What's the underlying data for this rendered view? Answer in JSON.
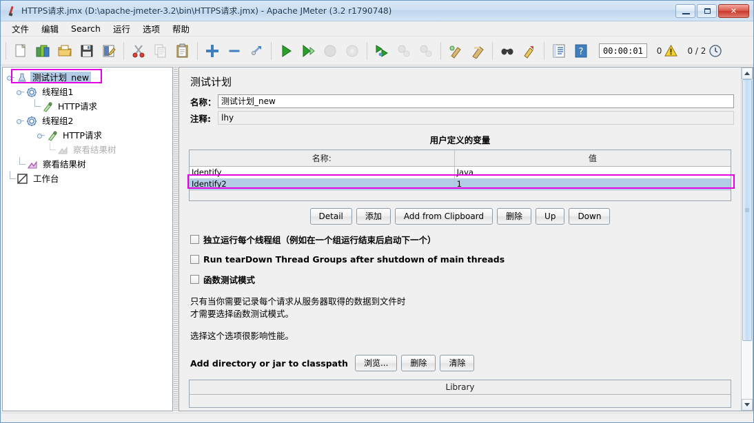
{
  "window": {
    "title": "HTTPS请求.jmx (D:\\apache-jmeter-3.2\\bin\\HTTPS请求.jmx) - Apache JMeter (3.2 r1790748)",
    "app_icon": "jmeter-feather-icon",
    "minimize_label": "–",
    "maximize_label": "□",
    "close_label": "✕"
  },
  "menubar": {
    "items": [
      {
        "label": "文件",
        "name": "menu-file"
      },
      {
        "label": "编辑",
        "name": "menu-edit"
      },
      {
        "label": "Search",
        "name": "menu-search"
      },
      {
        "label": "运行",
        "name": "menu-run"
      },
      {
        "label": "选项",
        "name": "menu-options"
      },
      {
        "label": "帮助",
        "name": "menu-help"
      }
    ]
  },
  "toolbar": {
    "buttons": [
      {
        "name": "new-icon",
        "title": "New"
      },
      {
        "name": "templates-icon",
        "title": "Templates"
      },
      {
        "name": "open-icon",
        "title": "Open"
      },
      {
        "name": "save-icon",
        "title": "Save"
      },
      {
        "name": "save-as-icon",
        "title": "Save as"
      },
      {
        "name": "cut-icon",
        "title": "Cut"
      },
      {
        "name": "copy-icon",
        "title": "Copy"
      },
      {
        "name": "paste-icon",
        "title": "Paste"
      },
      {
        "name": "expand-all-icon",
        "title": "Expand all"
      },
      {
        "name": "collapse-all-icon",
        "title": "Collapse all"
      },
      {
        "name": "toggle-icon",
        "title": "Toggle"
      },
      {
        "name": "start-icon",
        "title": "Start"
      },
      {
        "name": "start-no-pauses-icon",
        "title": "Start no pauses"
      },
      {
        "name": "stop-icon",
        "title": "Stop"
      },
      {
        "name": "shutdown-icon",
        "title": "Shutdown"
      },
      {
        "name": "remote-start-all-icon",
        "title": "Remote start all"
      },
      {
        "name": "remote-stop-all-icon",
        "title": "Remote stop all"
      },
      {
        "name": "remote-shutdown-all-icon",
        "title": "Remote shutdown all"
      },
      {
        "name": "clear-icon",
        "title": "Clear"
      },
      {
        "name": "clear-all-icon",
        "title": "Clear all"
      },
      {
        "name": "search-icon",
        "title": "Search"
      },
      {
        "name": "reset-search-icon",
        "title": "Reset search"
      },
      {
        "name": "function-helper-icon",
        "title": "Function helper dialog"
      },
      {
        "name": "help-icon",
        "title": "Help"
      }
    ],
    "elapsed_time": "00:00:01",
    "warning_count": "0",
    "warning_icon": "warning-triangle-icon",
    "thread_counter": "0 / 2",
    "clock_icon": "clock-icon"
  },
  "tree": {
    "nodes": [
      {
        "label": "测试计划_new",
        "icon": "test-plan-icon",
        "indent": 0,
        "selected": true,
        "disabled": false,
        "highlighted": true,
        "has_handle": true
      },
      {
        "label": "线程组1",
        "icon": "thread-group-icon",
        "indent": 1,
        "selected": false,
        "disabled": false,
        "highlighted": false,
        "has_handle": true
      },
      {
        "label": "HTTP请求",
        "icon": "http-request-icon",
        "indent": 2,
        "selected": false,
        "disabled": false,
        "highlighted": false,
        "has_handle": false
      },
      {
        "label": "线程组2",
        "icon": "thread-group-icon",
        "indent": 1,
        "selected": false,
        "disabled": false,
        "highlighted": false,
        "has_handle": true
      },
      {
        "label": "HTTP请求",
        "icon": "http-request-icon",
        "indent": 2,
        "selected": false,
        "disabled": false,
        "highlighted": false,
        "has_handle": true
      },
      {
        "label": "察看结果树",
        "icon": "view-results-tree-icon",
        "indent": 3,
        "selected": false,
        "disabled": true,
        "highlighted": false,
        "has_handle": false
      },
      {
        "label": "察看结果树",
        "icon": "view-results-tree-icon",
        "indent": 1,
        "selected": false,
        "disabled": false,
        "highlighted": false,
        "has_handle": false
      },
      {
        "label": "工作台",
        "icon": "workbench-icon",
        "indent": 0,
        "selected": false,
        "disabled": false,
        "highlighted": false,
        "has_handle": false
      }
    ]
  },
  "main": {
    "panel_title": "测试计划",
    "name_label": "名称：",
    "name_value": "测试计划_new",
    "comment_label": "注释:",
    "comment_value": "lhy",
    "variables_section_title": "用户定义的变量",
    "variables_table": {
      "headers": [
        "名称:",
        "值"
      ],
      "rows": [
        {
          "name": "Identify",
          "value": "Java",
          "selected": false
        },
        {
          "name": "Identify2",
          "value": "1",
          "selected": true
        }
      ]
    },
    "table_buttons": [
      {
        "label": "Detail",
        "name": "detail-button"
      },
      {
        "label": "添加",
        "name": "add-button"
      },
      {
        "label": "Add from Clipboard",
        "name": "add-from-clipboard-button"
      },
      {
        "label": "删除",
        "name": "delete-button"
      },
      {
        "label": "Up",
        "name": "up-button"
      },
      {
        "label": "Down",
        "name": "down-button"
      }
    ],
    "checkboxes": [
      {
        "label": "独立运行每个线程组（例如在一个组运行结束后启动下一个）",
        "checked": false,
        "bold": true,
        "name": "run-thread-groups-serially-checkbox"
      },
      {
        "label": "Run tearDown Thread Groups after shutdown of main threads",
        "checked": false,
        "bold": true,
        "name": "run-teardown-checkbox"
      },
      {
        "label": "函数测试模式",
        "checked": false,
        "bold": true,
        "name": "functional-test-mode-checkbox"
      }
    ],
    "help_line1": "只有当你需要记录每个请求从服务器取得的数据到文件时",
    "help_line2": "才需要选择函数测试模式。",
    "help_line3": "选择这个选项很影响性能。",
    "classpath_label": "Add directory or jar to classpath",
    "classpath_buttons": [
      {
        "label": "浏览...",
        "name": "browse-button"
      },
      {
        "label": "删除",
        "name": "classpath-delete-button"
      },
      {
        "label": "清除",
        "name": "classpath-clear-button"
      }
    ],
    "library_header": "Library"
  }
}
